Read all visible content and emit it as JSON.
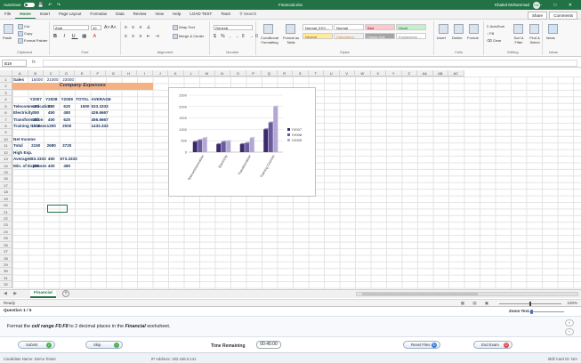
{
  "titlebar": {
    "autosave": "AutoSave",
    "toggle": "Off",
    "title": "Financial.xlsx",
    "user": "Khaled Mohammad",
    "initials": "KM"
  },
  "tabs": [
    "File",
    "Home",
    "Insert",
    "Page Layout",
    "Formulas",
    "Data",
    "Review",
    "View",
    "Help",
    "LOAD TEST",
    "Team"
  ],
  "search": "Search",
  "share": "Share",
  "comments": "Comments",
  "ribbon": {
    "paste": "Paste",
    "cut": "Cut",
    "copy": "Copy",
    "format_painter": "Format Painter",
    "font_name": "Arial",
    "font_size": "10",
    "wrap_text": "Wrap Text",
    "merge_center": "Merge & Center",
    "number_format": "General",
    "conditional": "Conditional Formatting",
    "format_table": "Format as Table",
    "styles": [
      {
        "label": "Normal_EXC...",
        "bg": "#ffffff",
        "fg": "#222222"
      },
      {
        "label": "Normal",
        "bg": "#ffffff",
        "fg": "#222222"
      },
      {
        "label": "Bad",
        "bg": "#ffc7ce",
        "fg": "#9c0006"
      },
      {
        "label": "Good",
        "bg": "#c6efce",
        "fg": "#006100"
      },
      {
        "label": "Neutral",
        "bg": "#ffeb9c",
        "fg": "#9c5700"
      },
      {
        "label": "Calculation",
        "bg": "#f2f2f2",
        "fg": "#fa7d00"
      },
      {
        "label": "Check Cell",
        "bg": "#a5a5a5",
        "fg": "#ffffff"
      },
      {
        "label": "Explanatory ...",
        "bg": "#ffffff",
        "fg": "#7f7f7f"
      }
    ],
    "insert": "Insert",
    "delete": "Delete",
    "format": "Format",
    "autosum": "AutoSum",
    "fill": "Fill",
    "clear": "Clear",
    "sort_filter": "Sort & Filter",
    "find_select": "Find & Select",
    "ideas": "Ideas",
    "groups": [
      "Clipboard",
      "Font",
      "Alignment",
      "Number",
      "Styles",
      "Cells",
      "Editing",
      "Ideas"
    ]
  },
  "formula": {
    "namebox": "B19",
    "fx": "fx"
  },
  "columns": [
    "A",
    "B",
    "C",
    "D",
    "E",
    "F",
    "G",
    "H",
    "I",
    "J",
    "K",
    "L",
    "M",
    "N",
    "O",
    "P",
    "Q",
    "R",
    "S",
    "T",
    "U",
    "V",
    "W",
    "X",
    "Y",
    "Z",
    "AA",
    "AB",
    "AC"
  ],
  "rows": [
    "1",
    "2",
    "3",
    "4",
    "5",
    "6",
    "7",
    "8",
    "9",
    "10",
    "11",
    "12",
    "13",
    "14",
    "15",
    "16",
    "17",
    "18",
    "19",
    "20",
    "21",
    "22",
    "23",
    "24",
    "25",
    "26",
    "27",
    "28",
    "29",
    "30",
    "31",
    "32"
  ],
  "sheet": {
    "sales_label": "Sales",
    "sales": [
      "15000",
      "21000",
      "23000"
    ],
    "title": "Company Expenses",
    "headers": [
      "Y2007",
      "Y2008",
      "Y2009",
      "TOTAL",
      "AVERAGE"
    ],
    "rows": [
      {
        "label": "Telecommunication",
        "v": [
          "450",
          "530",
          "620"
        ],
        "total": "1600",
        "avg": "533.3333"
      },
      {
        "label": "Electricity",
        "v": [
          "350",
          "450",
          "480"
        ],
        "total": "",
        "avg": "426.6667"
      },
      {
        "label": "Transformation",
        "v": [
          "350",
          "400",
          "620"
        ],
        "total": "",
        "avg": "456.6667"
      },
      {
        "label": "Training Courses",
        "v": [
          "1000",
          "1300",
          "2000"
        ],
        "total": "",
        "avg": "1433.333"
      }
    ],
    "net_income": "Net Income",
    "total_label": "Total",
    "total": [
      "2150",
      "2680",
      "3720"
    ],
    "high_exp": "High Exp.",
    "average_label": "Average",
    "average": [
      "383.3333",
      "450",
      "573.3333"
    ],
    "min_label": "Min. of Expenses",
    "min": [
      "350",
      "400",
      "480"
    ]
  },
  "chart_data": {
    "type": "bar",
    "categories": [
      "Telecommunication",
      "Electricity",
      "Transformation",
      "Training Courses"
    ],
    "series": [
      {
        "name": "Y2007",
        "values": [
          450,
          350,
          350,
          1000
        ],
        "color": "#3b2a6b"
      },
      {
        "name": "Y2008",
        "values": [
          530,
          450,
          400,
          1300
        ],
        "color": "#6a5a9e"
      },
      {
        "name": "Y2009",
        "values": [
          620,
          480,
          620,
          2000
        ],
        "color": "#b3a8d4"
      }
    ],
    "y_ticks": [
      "0",
      "500",
      "1000",
      "1500",
      "2000",
      "2500"
    ],
    "ylim": [
      0,
      2500
    ],
    "legend": "right"
  },
  "sheet_tab": "Financial",
  "status": {
    "ready": "Ready",
    "zoom": "100%"
  },
  "exam": {
    "question": "Question 1 / 5",
    "zoom_text": "Zoom Text",
    "task_pre": "Format the ",
    "task_range": "cell range F5:F8",
    "task_mid": " to 2 decimal places in the ",
    "task_sheet": "Financial",
    "task_post": " worksheet.",
    "submit": "Submit",
    "skip": "Skip",
    "time_label": "Time Remaining",
    "time": "00:45:00",
    "reset": "Reset Files",
    "end": "End Exam",
    "candidate": "Candidate Name: Demo Tester",
    "ip": "IP Address: 192.168.0.141",
    "skill": "Skill Card ID: N/A"
  }
}
